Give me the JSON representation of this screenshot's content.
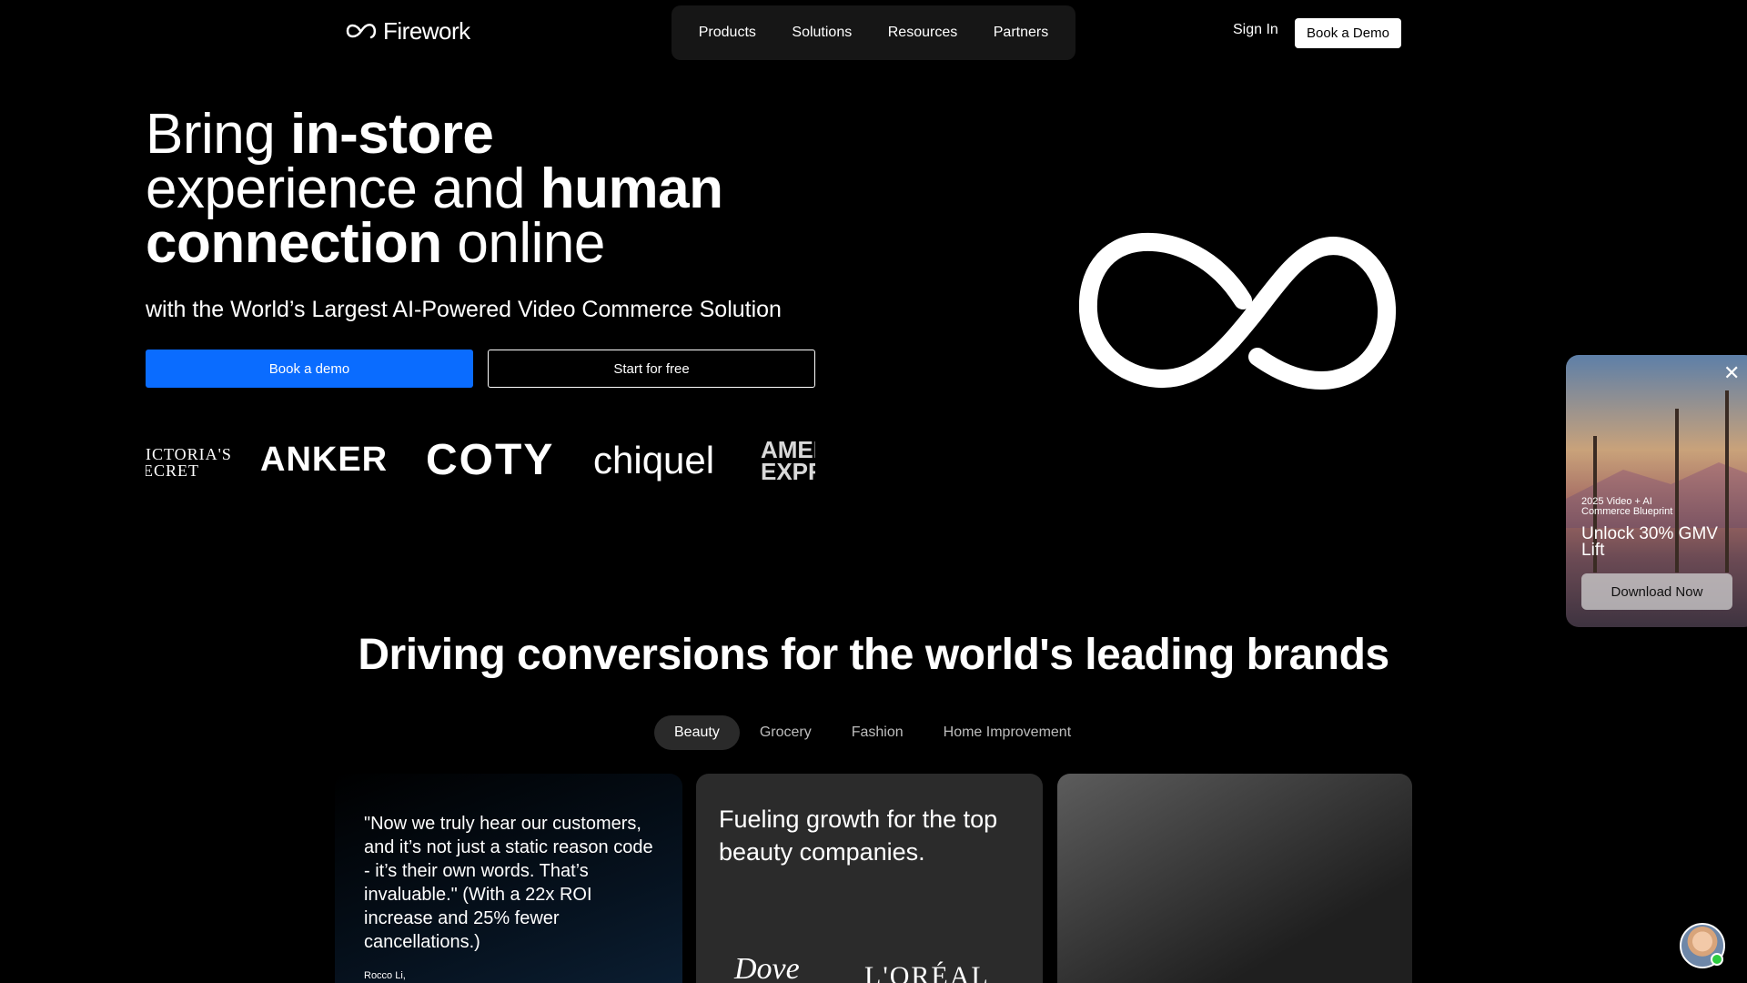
{
  "header": {
    "logo_text": "Firework",
    "nav": [
      "Products",
      "Solutions",
      "Resources",
      "Partners"
    ],
    "sign_in": "Sign In",
    "book_demo": "Book a Demo"
  },
  "hero": {
    "title": {
      "l1a": "Bring ",
      "l1b": "in-store",
      "l2a": "experience and ",
      "l2b": "human",
      "l3a": "connection",
      "l3b": " online"
    },
    "subtitle": "with the World’s Largest AI-Powered Video Commerce Solution",
    "cta_primary": "Book a demo",
    "cta_secondary": "Start for free",
    "brands": {
      "vs": "VICTORIA'S SECRET",
      "anker": "ANKER",
      "coty": "COTY",
      "chiquel": "chiquel",
      "amex": "AMERICAN EXPRESS"
    }
  },
  "promo": {
    "kicker": "2025 Video + AI Commerce Blueprint",
    "title": "Unlock 30% GMV Lift",
    "button": "Download Now",
    "close": "✕"
  },
  "section": {
    "title": "Driving conversions for the world's leading brands",
    "tabs": [
      "Beauty",
      "Grocery",
      "Fashion",
      "Home Improvement"
    ],
    "active_tab": "Beauty"
  },
  "cards": {
    "quote": "\"Now we truly hear our customers, and it’s not just a static reason code - it’s their own words. That’s invaluable.\" (With a 22x ROI increase and 25% fewer cancellations.)",
    "quote_author": "Rocco Li,",
    "card2_title": "Fueling growth for the top beauty companies.",
    "logo_dove": "Dove",
    "logo_loreal": "L'ORÉAL"
  },
  "colors": {
    "accent": "#0a6cff",
    "background": "#000000"
  }
}
